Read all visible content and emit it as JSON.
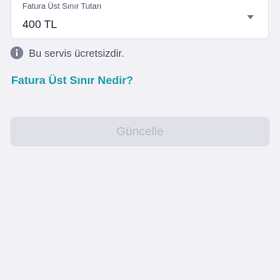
{
  "limit_select": {
    "label": "Fatura Üst Sınır Tutarı",
    "value": "400 TL",
    "icon": "chevron-down-icon"
  },
  "info": {
    "icon": "info-icon",
    "text": "Bu servis ücretsizdir."
  },
  "faq_link": {
    "label": "Fatura Üst Sınır Nedir?"
  },
  "update_button": {
    "label": "Güncelle",
    "state": "disabled"
  },
  "colors": {
    "background": "#f2f2f6",
    "accent": "#1a9aa8",
    "button_disabled_bg": "#dfe0e8",
    "button_disabled_text": "#b7b9c4"
  }
}
